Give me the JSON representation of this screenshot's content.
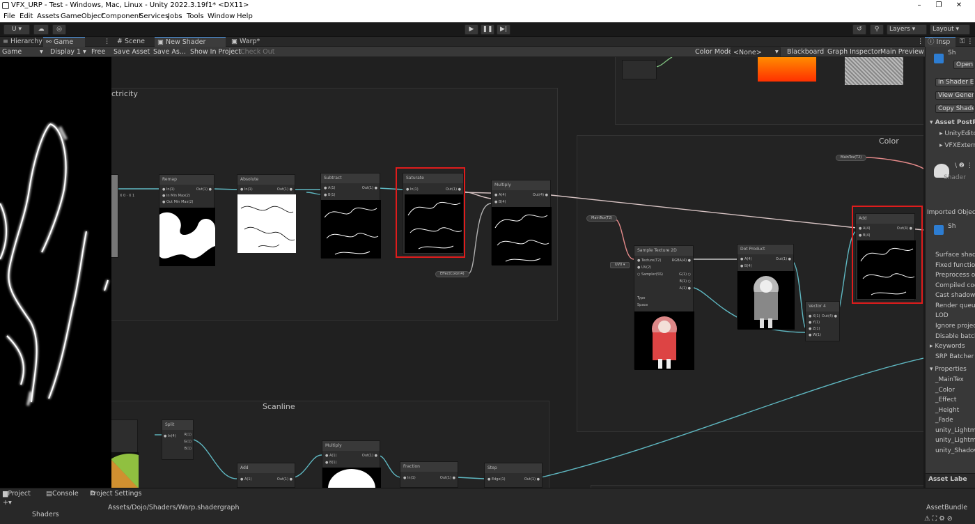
{
  "window": {
    "title": "VFX_URP - Test - Windows, Mac, Linux - Unity 2022.3.19f1* <DX11>",
    "controls": [
      "–",
      "❐",
      "✕"
    ]
  },
  "menu": [
    "File",
    "Edit",
    "Assets",
    "GameObject",
    "Component",
    "Services",
    "Jobs",
    "Tools",
    "Window",
    "Help"
  ],
  "toolbar": {
    "account": "U ▾",
    "layers": "Layers",
    "layout": "Layout"
  },
  "left_tabs": {
    "hierarchy": "Hierarchy",
    "game": "Game",
    "game_mode": "Game",
    "display": "Display 1",
    "aspect": "Free A"
  },
  "center_tabs": {
    "scene": "Scene",
    "shader_graph": "New Shader Graph",
    "warp": "Warp*"
  },
  "graph_toolbar": {
    "save_asset": "Save Asset",
    "save_as": "Save As...",
    "show_in_project": "Show In Project",
    "check_out": "Check Out",
    "color_mode_label": "Color Mode",
    "color_mode_value": "<None>",
    "blackboard": "Blackboard",
    "graph_inspector": "Graph Inspector",
    "main_preview": "Main Preview"
  },
  "groups": {
    "electricity": "ctricity",
    "color": "Color",
    "scanline": "Scanline"
  },
  "nodes": {
    "remap": "Remap",
    "absolute": "Absolute",
    "subtract": "Subtract",
    "saturate": "Saturate",
    "multiply": "Multiply",
    "sample_texture": "Sample Texture 2D",
    "dot_product": "Dot Product",
    "vector4": "Vector 4",
    "add": "Add",
    "split": "Split",
    "add2": "Add",
    "multiply2": "Multiply",
    "fraction": "Fraction",
    "step": "Step"
  },
  "pills": {
    "maintex1": "MainTex(T2)",
    "maintex2": "MainTex(T2)",
    "effectcolor": "EffectColor(4)",
    "uv0": "UV0 ▾"
  },
  "inspector": {
    "tab": "Insp",
    "open": "Open",
    "sh1": "Sh",
    "in_shader_ed": "in Shader Ec",
    "view_generated": "View Genera",
    "copy_shader": "Copy Shade",
    "asset_postpr": "Asset PostPr",
    "unity_editor": "UnityEdito",
    "vfx_extern": "VFXExtern",
    "shader_label": "Shader",
    "imported_object": "Imported Object",
    "sh2": "Sh",
    "props": [
      "Surface shade",
      "Fixed function",
      "Preprocess on",
      "Compiled code",
      "Cast shadows",
      "Render queue",
      "LOD",
      "Ignore projecto",
      "Disable batchi"
    ],
    "keywords": "Keywords",
    "srp_batcher": "SRP Batcher",
    "properties": "Properties",
    "prop_list": [
      "_MainTex",
      "_Color",
      "_Effect",
      "_Height",
      "_Fade",
      "unity_Lightmap",
      "unity_Lightmap",
      "unity_Shadow"
    ],
    "asset_labels": "Asset Labe",
    "asset_bundle": "AssetBundle"
  },
  "bottom": {
    "project": "Project",
    "console": "Console",
    "project_settings": "Project Settings",
    "path": "Assets/Dojo/Shaders/Warp.shadergraph",
    "shaders": "Shaders",
    "breadcrumb": "Assets > Dojo > Shaders"
  }
}
